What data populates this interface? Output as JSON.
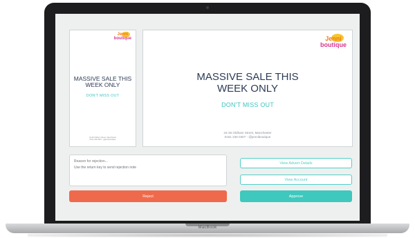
{
  "device": {
    "brand": "MacBook"
  },
  "advert": {
    "logo_line1": "Jenni",
    "logo_line2": "boutique",
    "headline": "MASSIVE SALE THIS WEEK ONLY",
    "subline": "DON'T MISS OUT",
    "address_line1": "34-36 Oldham Street, Manchester",
    "address_line2": "0161 236 0307 - @jenniboutique"
  },
  "rejection": {
    "placeholder": "Reason for rejection...",
    "hint": "Use the return key to send rejection note"
  },
  "actions": {
    "reject_label": "Reject",
    "view_details_label": "View Advert Details",
    "view_account_label": "View Account",
    "approve_label": "Approve"
  },
  "colors": {
    "reject": "#ef6a4c",
    "approve": "#3fc8bd",
    "accent_text": "#3fc4c0",
    "headline_text": "#2b3a55"
  }
}
